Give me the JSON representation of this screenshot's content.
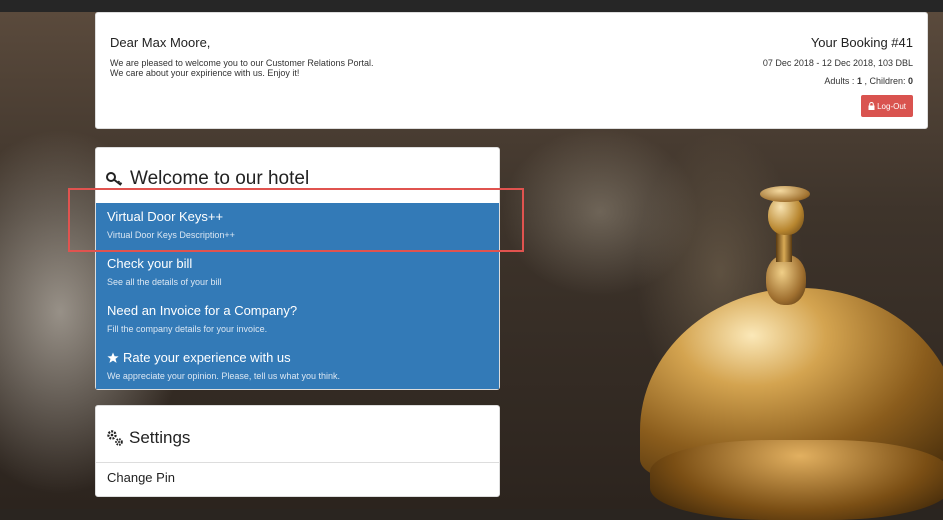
{
  "header": {
    "greeting": "Dear Max Moore,",
    "welcome_line1": "We are pleased to welcome you to our Customer Relations Portal.",
    "welcome_line2": "We care about your expirience with us. Enjoy it!",
    "booking_title": "Your Booking #41",
    "booking_dates": "07 Dec 2018 - 12 Dec 2018, 103 DBL",
    "adults_label": "Adults : ",
    "adults_value": "1",
    "children_label": " , Children: ",
    "children_value": "0",
    "logout_label": "Log-Out",
    "logout_icon": "lock-icon"
  },
  "menu": {
    "heading": "Welcome to our hotel",
    "heading_icon": "key-icon",
    "items": [
      {
        "title": "Virtual Door Keys++",
        "desc": "Virtual Door Keys Description++"
      },
      {
        "title": "Check your bill",
        "desc": "See all the details of your bill"
      },
      {
        "title": "Need an Invoice for a Company?",
        "desc": "Fill the company details for your invoice."
      },
      {
        "title": "Rate your experience with us",
        "desc": "We appreciate your opinion. Please, tell us what you think.",
        "icon": "star-icon"
      }
    ]
  },
  "settings": {
    "heading": "Settings",
    "heading_icon": "gears-icon",
    "items": [
      {
        "label": "Change Pin"
      }
    ]
  },
  "colors": {
    "accent": "#337ab7",
    "logout": "#d9534f",
    "highlight": "#e0534f"
  }
}
